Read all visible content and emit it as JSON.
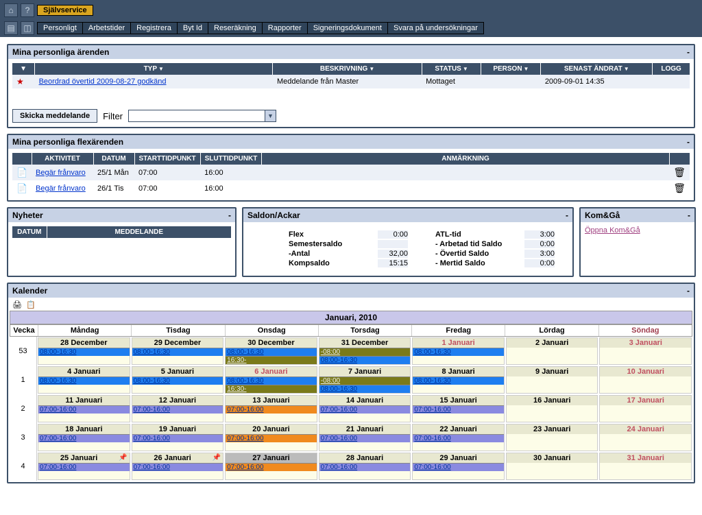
{
  "topbar": {
    "active_tab": "Självservice",
    "menu": [
      "Personligt",
      "Arbetstider",
      "Registrera",
      "Byt Id",
      "Reseräkning",
      "Rapporter",
      "Signeringsdokument",
      "Svara på undersökningar"
    ]
  },
  "panel_arenden": {
    "title": "Mina personliga ärenden",
    "cols": {
      "typ": "TYP",
      "beskr": "BESKRIVNING",
      "status": "STATUS",
      "person": "PERSON",
      "senast": "SENAST ÄNDRAT",
      "logg": "LOGG"
    },
    "row": {
      "typ": "Beordrad övertid 2009-08-27 godkänd",
      "beskr": "Meddelande från Master",
      "status": "Mottaget",
      "person": "",
      "senast": "2009-09-01 14:35",
      "logg": ""
    },
    "send_btn": "Skicka meddelande",
    "filter_label": "Filter"
  },
  "panel_flex": {
    "title": "Mina personliga flexärenden",
    "cols": {
      "akt": "AKTIVITET",
      "datum": "DATUM",
      "start": "STARTTIDPUNKT",
      "slut": "SLUTTIDPUNKT",
      "anm": "ANMÄRKNING"
    },
    "rows": [
      {
        "akt": "Begär frånvaro",
        "datum": "25/1 Mån",
        "start": "07:00",
        "slut": "16:00"
      },
      {
        "akt": "Begär frånvaro",
        "datum": "26/1 Tis",
        "start": "07:00",
        "slut": "16:00"
      }
    ]
  },
  "panel_nyheter": {
    "title": "Nyheter",
    "cols": {
      "datum": "DATUM",
      "medd": "MEDDELANDE"
    }
  },
  "panel_saldo": {
    "title": "Saldon/Ackar",
    "left": [
      {
        "lab": "Flex",
        "val": "0:00"
      },
      {
        "lab": "Semestersaldo",
        "val": ""
      },
      {
        "lab": "-Antal",
        "val": "32,00"
      },
      {
        "lab": "Kompsaldo",
        "val": "15:15"
      }
    ],
    "right": [
      {
        "lab": "ATL-tid",
        "val": "3:00"
      },
      {
        "lab": "- Arbetad tid Saldo",
        "val": "0:00"
      },
      {
        "lab": "- Övertid Saldo",
        "val": "3:00"
      },
      {
        "lab": "- Mertid Saldo",
        "val": "0:00"
      }
    ]
  },
  "panel_komga": {
    "title": "Kom&Gå",
    "link": "Öppna Kom&Gå"
  },
  "calendar": {
    "title": "Kalender",
    "month": "Januari, 2010",
    "week_label": "Vecka",
    "days": [
      "Måndag",
      "Tisdag",
      "Onsdag",
      "Torsdag",
      "Fredag",
      "Lördag",
      "Söndag"
    ],
    "rows": [
      {
        "wk": "53",
        "cells": [
          {
            "d": "28 December",
            "slots": [
              {
                "t": "08:00-16:30",
                "c": "blue"
              }
            ]
          },
          {
            "d": "29 December",
            "slots": [
              {
                "t": "08:00-16:30",
                "c": "blue"
              }
            ]
          },
          {
            "d": "30 December",
            "slots": [
              {
                "t": "08:00-16:30",
                "c": "blue"
              },
              {
                "t": "16:30-",
                "c": "olive"
              }
            ]
          },
          {
            "d": "31 December",
            "slots": [
              {
                "t": "-08:00",
                "c": "olive"
              },
              {
                "t": "08:00-16:30",
                "c": "blue"
              }
            ]
          },
          {
            "d": "1 Januari",
            "red": true,
            "slots": [
              {
                "t": "08:00-16:30",
                "c": "blue"
              }
            ]
          },
          {
            "d": "2 Januari",
            "slots": []
          },
          {
            "d": "3 Januari",
            "red": true,
            "slots": []
          }
        ]
      },
      {
        "wk": "1",
        "cells": [
          {
            "d": "4 Januari",
            "slots": [
              {
                "t": "08:00-16:30",
                "c": "blue"
              }
            ]
          },
          {
            "d": "5 Januari",
            "slots": [
              {
                "t": "08:00-16:30",
                "c": "blue"
              }
            ]
          },
          {
            "d": "6 Januari",
            "red": true,
            "slots": [
              {
                "t": "08:00-16:30",
                "c": "blue"
              },
              {
                "t": "16:30-",
                "c": "olive"
              }
            ]
          },
          {
            "d": "7 Januari",
            "slots": [
              {
                "t": "-08:00",
                "c": "olive"
              },
              {
                "t": "08:00-16:30",
                "c": "blue"
              }
            ]
          },
          {
            "d": "8 Januari",
            "slots": [
              {
                "t": "08:00-16:30",
                "c": "blue"
              }
            ]
          },
          {
            "d": "9 Januari",
            "slots": []
          },
          {
            "d": "10 Januari",
            "red": true,
            "slots": []
          }
        ]
      },
      {
        "wk": "2",
        "cells": [
          {
            "d": "11 Januari",
            "slots": [
              {
                "t": "07:00-16:00",
                "c": "purple"
              }
            ]
          },
          {
            "d": "12 Januari",
            "slots": [
              {
                "t": "07:00-16:00",
                "c": "purple"
              }
            ]
          },
          {
            "d": "13 Januari",
            "slots": [
              {
                "t": "07:00-16:00",
                "c": "orange"
              }
            ]
          },
          {
            "d": "14 Januari",
            "slots": [
              {
                "t": "07:00-16:00",
                "c": "purple"
              }
            ]
          },
          {
            "d": "15 Januari",
            "slots": [
              {
                "t": "07:00-16:00",
                "c": "purple"
              }
            ]
          },
          {
            "d": "16 Januari",
            "slots": []
          },
          {
            "d": "17 Januari",
            "red": true,
            "slots": []
          }
        ]
      },
      {
        "wk": "3",
        "cells": [
          {
            "d": "18 Januari",
            "slots": [
              {
                "t": "07:00-16:00",
                "c": "purple"
              }
            ]
          },
          {
            "d": "19 Januari",
            "slots": [
              {
                "t": "07:00-16:00",
                "c": "purple"
              }
            ]
          },
          {
            "d": "20 Januari",
            "slots": [
              {
                "t": "07:00-16:00",
                "c": "orange"
              }
            ]
          },
          {
            "d": "21 Januari",
            "slots": [
              {
                "t": "07:00-16:00",
                "c": "purple"
              }
            ]
          },
          {
            "d": "22 Januari",
            "slots": [
              {
                "t": "07:00-16:00",
                "c": "purple"
              }
            ]
          },
          {
            "d": "23 Januari",
            "slots": []
          },
          {
            "d": "24 Januari",
            "red": true,
            "slots": []
          }
        ]
      },
      {
        "wk": "4",
        "cells": [
          {
            "d": "25 Januari",
            "pin": true,
            "slots": [
              {
                "t": "07:00-16:00",
                "c": "purple"
              }
            ]
          },
          {
            "d": "26 Januari",
            "pin": true,
            "slots": [
              {
                "t": "07:00-16:00",
                "c": "purple"
              }
            ]
          },
          {
            "d": "27 Januari",
            "today": true,
            "slots": [
              {
                "t": "07:00-16:00",
                "c": "orange"
              }
            ]
          },
          {
            "d": "28 Januari",
            "slots": [
              {
                "t": "07:00-16:00",
                "c": "purple"
              }
            ]
          },
          {
            "d": "29 Januari",
            "slots": [
              {
                "t": "07:00-16:00",
                "c": "purple"
              }
            ]
          },
          {
            "d": "30 Januari",
            "slots": []
          },
          {
            "d": "31 Januari",
            "red": true,
            "slots": []
          }
        ]
      }
    ]
  }
}
